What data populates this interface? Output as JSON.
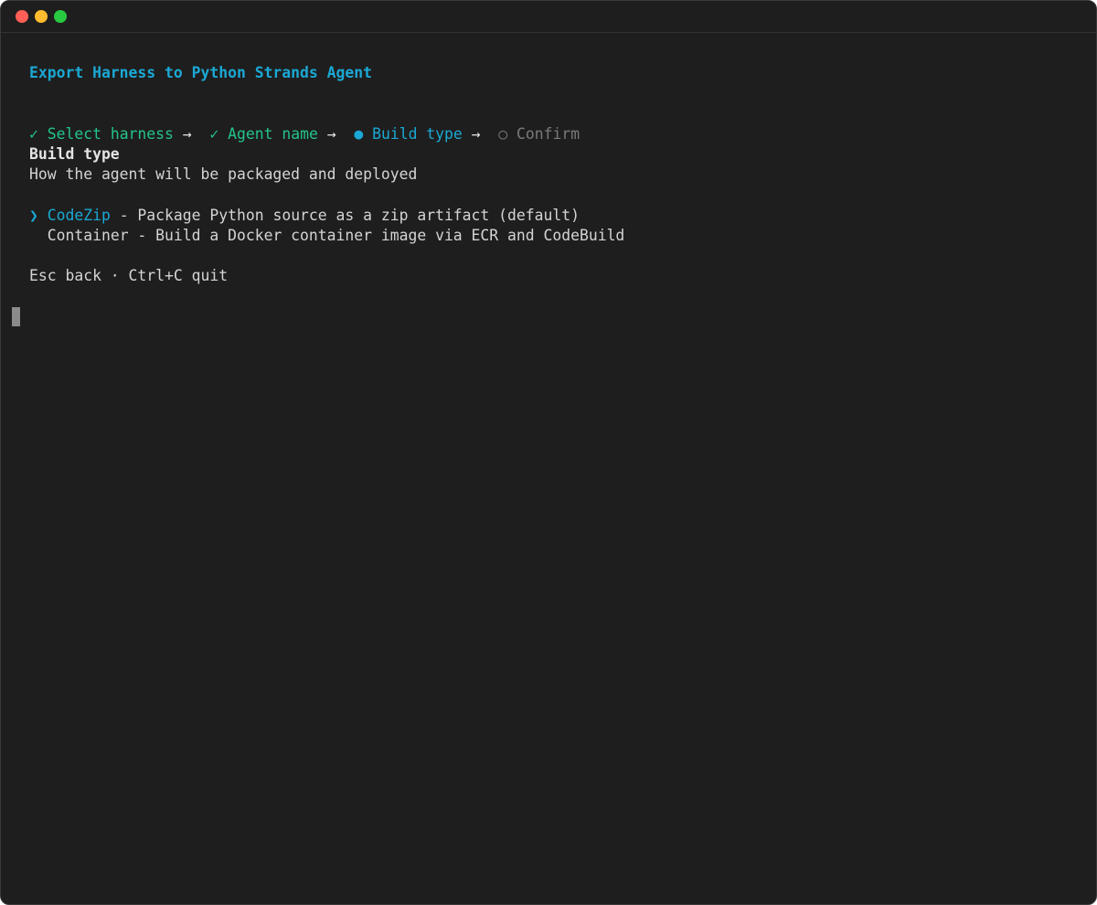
{
  "window": {
    "traffic_lights": [
      "close",
      "minimize",
      "zoom"
    ]
  },
  "header": {
    "title": "Export Harness to Python Strands Agent"
  },
  "steps": [
    {
      "marker": "✓",
      "label": "Select harness",
      "status": "done"
    },
    {
      "marker": "✓",
      "label": "Agent name",
      "status": "done"
    },
    {
      "marker": "●",
      "label": "Build type",
      "status": "active"
    },
    {
      "marker": "○",
      "label": "Confirm",
      "status": "pending"
    }
  ],
  "step_separator": "→",
  "section": {
    "heading": "Build type",
    "description": "How the agent will be packaged and deployed"
  },
  "options": [
    {
      "pointer": "❯",
      "name": "CodeZip",
      "description": " - Package Python source as a zip artifact (default)",
      "selected": true
    },
    {
      "pointer": "",
      "name": "Container",
      "description": " - Build a Docker container image via ECR and CodeBuild",
      "selected": false
    }
  ],
  "hint": "Esc back · Ctrl+C quit",
  "colors": {
    "background": "#1e1e1e",
    "accent": "#1ba8d4",
    "done": "#23c48a",
    "pending": "#7a7a7a",
    "text": "#d4d4d4"
  }
}
